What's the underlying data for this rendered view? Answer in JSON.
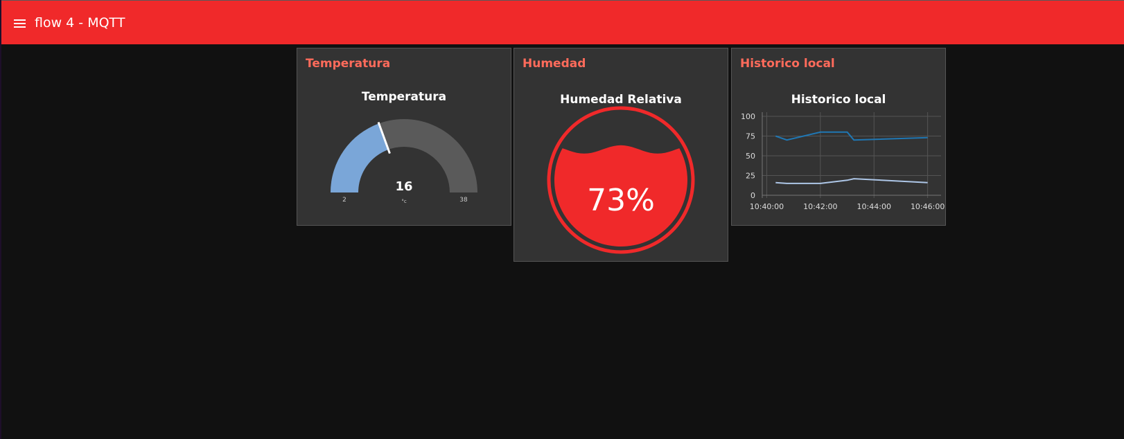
{
  "app": {
    "title": "flow 4 - MQTT",
    "accent": "#f0292a"
  },
  "temperature_card": {
    "card_title": "Temperatura",
    "gauge": {
      "title": "Temperatura",
      "value": "16",
      "numeric_value": 16,
      "unit": "°c",
      "min": "2",
      "max": "38",
      "min_value": 2,
      "max_value": 38,
      "fill_color": "#7aa6d8",
      "track_color": "#5a5a5a"
    }
  },
  "humidity_card": {
    "card_title": "Humedad",
    "widget": {
      "title": "Humedad Relativa",
      "value_text": "73%",
      "level": 0.73,
      "color": "#f0292a"
    }
  },
  "history_card": {
    "card_title": "Historico local",
    "chart_title": "Historico local",
    "chart_data": {
      "type": "line",
      "title": "Historico local",
      "y_ticks": [
        "100",
        "75",
        "50",
        "25",
        "0"
      ],
      "x_ticks": [
        "10:40:00",
        "10:42:00",
        "10:44:00",
        "10:46:00"
      ],
      "ylim": [
        0,
        100
      ],
      "xlim": [
        "10:39:50",
        "10:46:30"
      ],
      "grid": true,
      "series": [
        {
          "color": "#1f77b4",
          "x": [
            "10:40:20",
            "10:40:45",
            "10:42:00",
            "10:43:00",
            "10:43:15",
            "10:46:00"
          ],
          "values": [
            75,
            70,
            80,
            80,
            70,
            73
          ]
        },
        {
          "color": "#aec7e8",
          "x": [
            "10:40:20",
            "10:40:45",
            "10:42:00",
            "10:43:00",
            "10:43:15",
            "10:46:00"
          ],
          "values": [
            16,
            15,
            15,
            19,
            21,
            16
          ]
        }
      ]
    }
  }
}
